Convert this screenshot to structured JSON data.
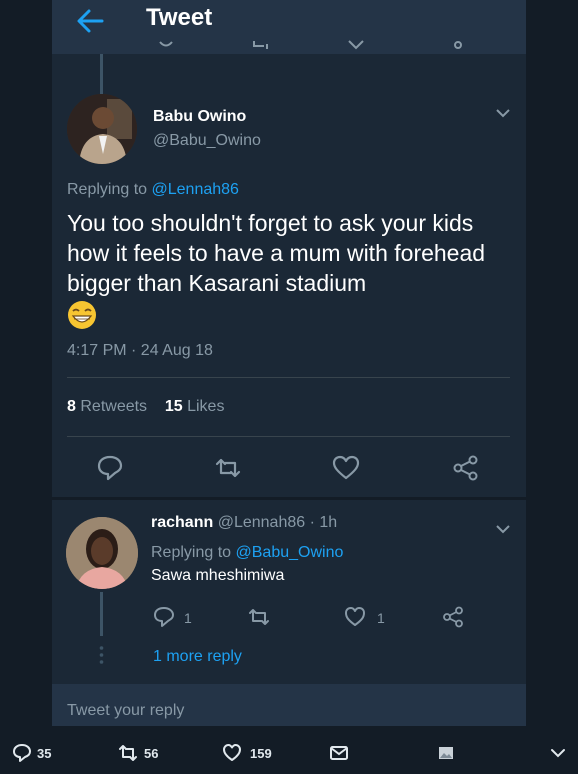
{
  "header": {
    "title": "Tweet"
  },
  "main_tweet": {
    "author_name": "Babu Owino",
    "author_handle": "@Babu_Owino",
    "replying_prefix": "Replying to ",
    "replying_to": "@Lennah86",
    "text": "You too shouldn't forget to ask your kids how it feels to have a mum with forehead bigger than Kasarani stadium",
    "emoji": "grinning-face-icon",
    "timestamp": "4:17 PM · 24 Aug 18",
    "retweets_count": "8",
    "retweets_label": "Retweets",
    "likes_count": "15",
    "likes_label": "Likes"
  },
  "reply": {
    "author_name": "rachann",
    "author_meta": "@Lennah86 · 1h",
    "replying_prefix": "Replying to ",
    "replying_to": "@Babu_Owino",
    "text": "Sawa mheshimiwa",
    "reply_count": "1",
    "like_count": "1",
    "more_replies": "1 more reply"
  },
  "compose": {
    "placeholder": "Tweet your reply"
  },
  "bottom_bar": {
    "replies": "35",
    "retweets": "56",
    "likes": "159"
  },
  "colors": {
    "background": "#1b2836",
    "header": "#243447",
    "accent": "#1da1f2",
    "muted": "#8899a6"
  }
}
